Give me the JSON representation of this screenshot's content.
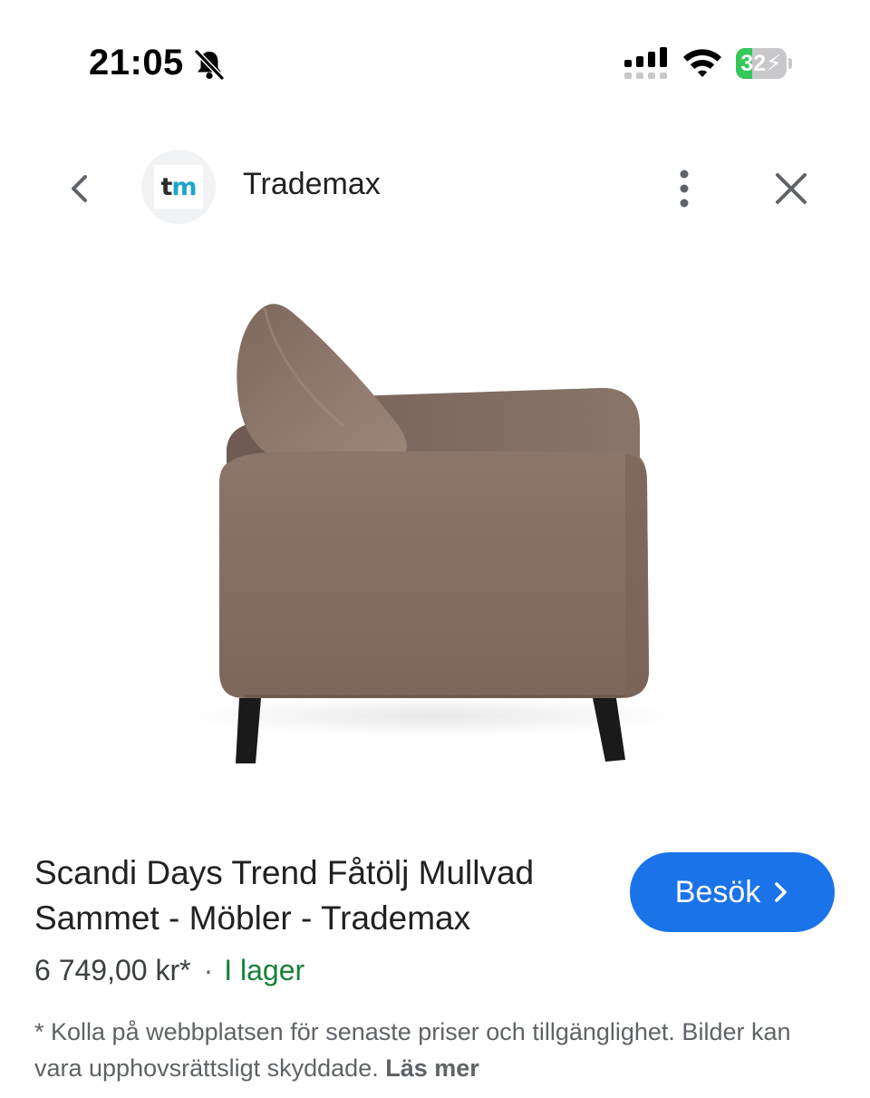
{
  "status_bar": {
    "time": "21:05",
    "battery_percent": "32",
    "battery_level": 0.32,
    "silent_mode": true,
    "charging": true
  },
  "header": {
    "site_name": "Trademax",
    "logo_text_t": "t",
    "logo_text_m": "m"
  },
  "product": {
    "title": "Scandi Days Trend Fåtölj Mullvad Sammet - Möbler - Trademax",
    "price": "6 749,00 kr*",
    "separator": "·",
    "stock": "I lager",
    "visit_label": "Besök",
    "disclaimer": "* Kolla på webbplatsen för senaste priser och tillgänglighet. Bilder kan vara upphovsrättsligt skyddade.",
    "read_more": "Läs mer"
  },
  "colors": {
    "accent": "#1a73e8",
    "in_stock": "#188038",
    "chair_fabric": "#8b7469",
    "battery_green": "#34c759"
  },
  "icons": {
    "back": "chevron-left-icon",
    "more": "more-vert-icon",
    "close": "close-icon",
    "silent": "bell-slash-icon",
    "signal": "cellular-signal-icon",
    "wifi": "wifi-icon"
  }
}
